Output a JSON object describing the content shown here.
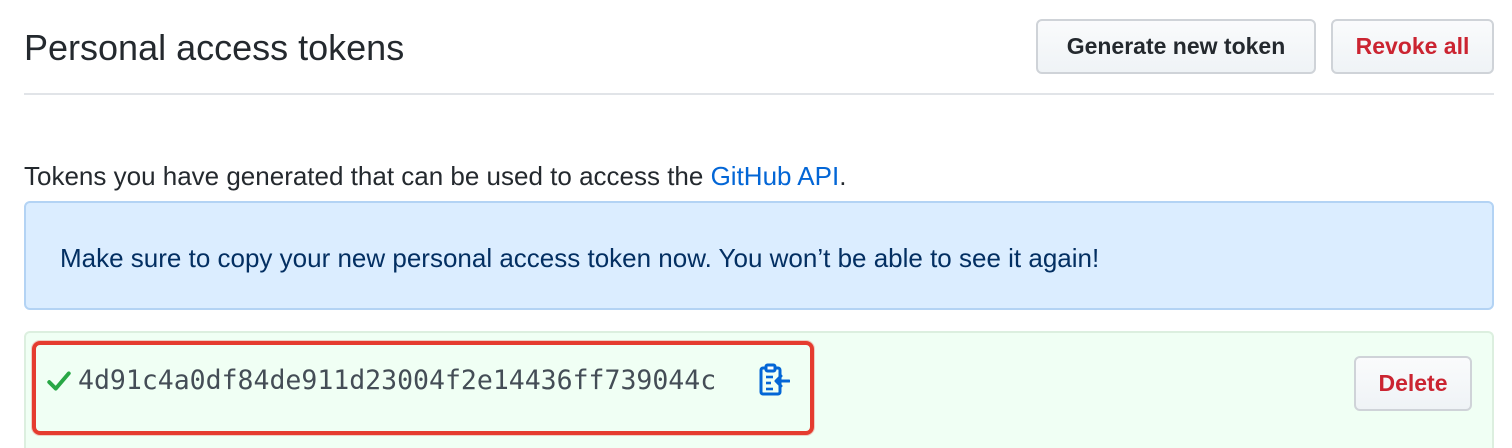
{
  "header": {
    "title": "Personal access tokens",
    "generate_label": "Generate new token",
    "revoke_label": "Revoke all"
  },
  "description": {
    "prefix": "Tokens you have generated that can be used to access the ",
    "link_text": "GitHub API",
    "suffix": "."
  },
  "flash": {
    "message": "Make sure to copy your new personal access token now. You won’t be able to see it again!"
  },
  "token": {
    "value": "4d91c4a0df84de911d23004f2e14436ff739044c",
    "delete_label": "Delete",
    "status_icon": "check-icon",
    "copy_icon": "clipboard-icon"
  },
  "colors": {
    "link": "#0366d6",
    "danger": "#cb2431",
    "success": "#28a745",
    "flash_bg": "#dbedff",
    "token_bg": "#f0fff4",
    "highlight": "#e53c2f"
  }
}
